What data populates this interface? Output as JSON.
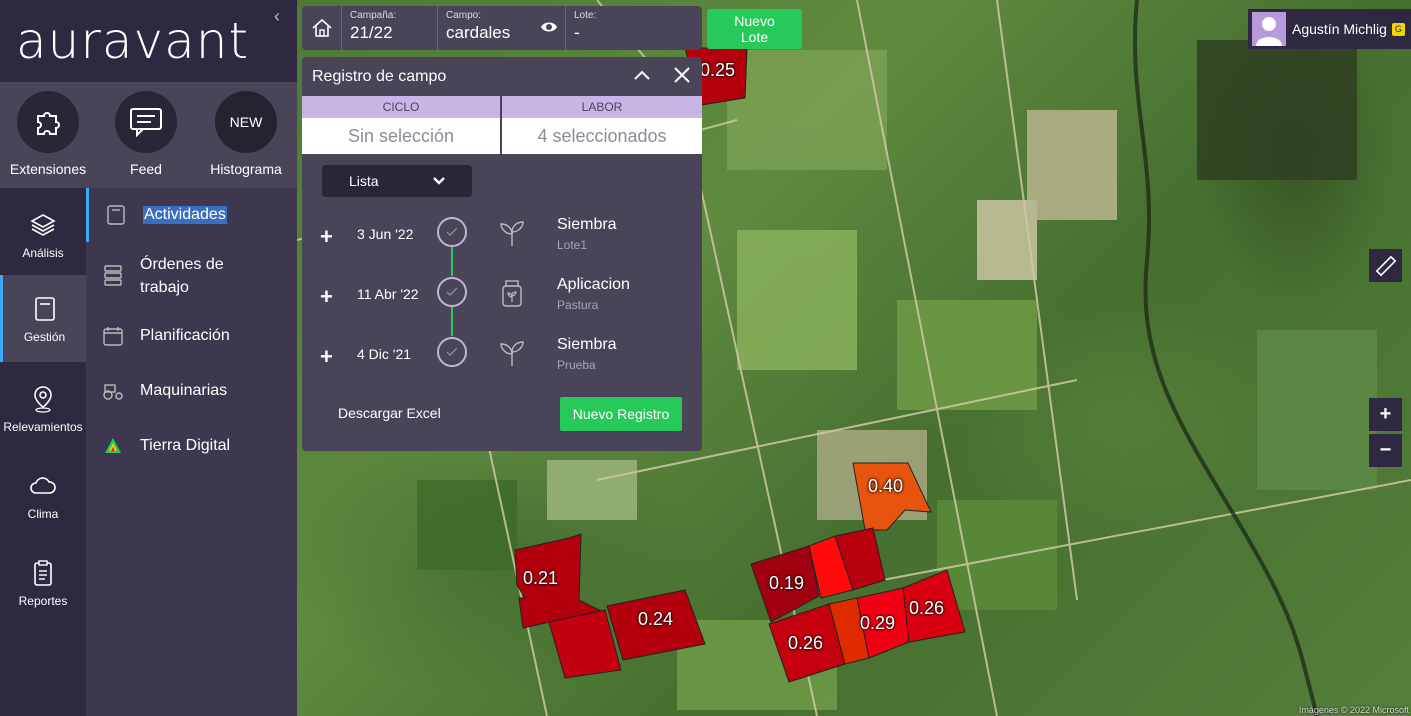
{
  "app": {
    "logo": "auravant"
  },
  "quick_actions": [
    {
      "label": "Extensiones",
      "icon": "puzzle-icon"
    },
    {
      "label": "Feed",
      "icon": "message-icon"
    },
    {
      "label": "Histograma",
      "icon_text": "NEW"
    }
  ],
  "rail": [
    {
      "label": "Análisis",
      "icon": "layers-icon"
    },
    {
      "label": "Gestión",
      "icon": "notebook-icon",
      "active": true
    },
    {
      "label": "Relevamientos",
      "icon": "map-pin-icon"
    },
    {
      "label": "Clima",
      "icon": "cloud-icon"
    },
    {
      "label": "Reportes",
      "icon": "clipboard-icon"
    }
  ],
  "submenu": [
    {
      "label": "Actividades",
      "icon": "notebook-icon",
      "active": true
    },
    {
      "label": "Órdenes de trabajo",
      "icon": "stack-icon"
    },
    {
      "label": "Planificación",
      "icon": "calendar-icon"
    },
    {
      "label": "Maquinarias",
      "icon": "tractor-icon"
    },
    {
      "label": "Tierra Digital",
      "icon": "tierra-digital-icon"
    }
  ],
  "topbar": {
    "campana_label": "Campaña:",
    "campana_value": "21/22",
    "campo_label": "Campo:",
    "campo_value": "cardales",
    "lote_label": "Lote:",
    "lote_value": "-"
  },
  "new_lote": {
    "line1": "Nuevo",
    "line2": "Lote"
  },
  "panel": {
    "title": "Registro de campo",
    "ciclo_label": "CICLO",
    "ciclo_value": "Sin selección",
    "labor_label": "LABOR",
    "labor_value": "4 seleccionados",
    "view_select": "Lista",
    "entries": [
      {
        "date": "3 Jun '22",
        "title": "Siembra",
        "subtitle": "Lote1",
        "icon": "sprout-icon"
      },
      {
        "date": "11 Abr '22",
        "title": "Aplicacion",
        "subtitle": "Pastura",
        "icon": "jar-icon"
      },
      {
        "date": "4 Dic '21",
        "title": "Siembra",
        "subtitle": "Prueba",
        "icon": "sprout-icon"
      }
    ],
    "download": "Descargar Excel",
    "new_record": "Nuevo Registro"
  },
  "user": {
    "name": "Agustín Michlig",
    "badge": "G"
  },
  "zoom": {
    "in": "+",
    "out": "−"
  },
  "map": {
    "lots": [
      {
        "value": "0.25",
        "color": "#b3000c"
      },
      {
        "value": "0.40",
        "color": "#e8530e"
      },
      {
        "value": "0.21",
        "color": "#b3000c"
      },
      {
        "value": "0.24",
        "color": "#b3000c"
      },
      {
        "value": "0.19",
        "color": "#a00010"
      },
      {
        "value": "0.26",
        "color": "#c5000f"
      },
      {
        "value": "0.29",
        "color": "#f00012"
      },
      {
        "value": "0.26",
        "color": "#d8000f"
      }
    ],
    "attribution": "Imágenes © 2022 Microsoft"
  }
}
